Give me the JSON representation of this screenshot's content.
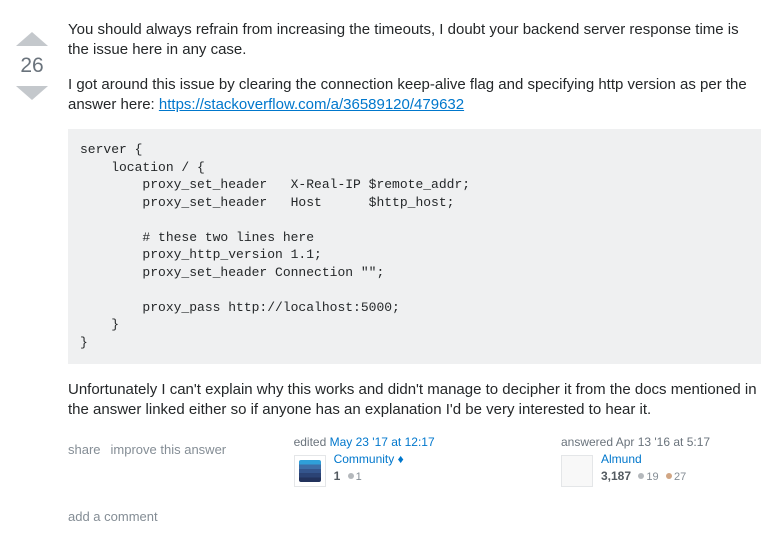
{
  "vote": {
    "count": "26"
  },
  "post": {
    "p1": "You should always refrain from increasing the timeouts, I doubt your backend server response time is the issue here in any case.",
    "p2a": "I got around this issue by clearing the connection keep-alive flag and specifying http version as per the answer here: ",
    "p2link": "https://stackoverflow.com/a/36589120/479632",
    "code": "server {\n    location / {\n        proxy_set_header   X-Real-IP $remote_addr;\n        proxy_set_header   Host      $http_host;\n\n        # these two lines here\n        proxy_http_version 1.1;\n        proxy_set_header Connection \"\";\n\n        proxy_pass http://localhost:5000;\n    }\n}",
    "p3": "Unfortunately I can't explain why this works and didn't manage to decipher it from the docs mentioned in the answer linked either so if anyone has an explanation I'd be very interested to hear it."
  },
  "menu": {
    "share": "share",
    "improve": "improve this answer"
  },
  "edited": {
    "action": "edited ",
    "time": "May 23 '17 at 12:17",
    "user": "Community",
    "flair": "♦",
    "rep": "1",
    "silver": "1"
  },
  "answered": {
    "action": "answered ",
    "time": "Apr 13 '16 at 5:17",
    "user": "Almund",
    "rep": "3,187",
    "silver": "19",
    "bronze": "27"
  },
  "comment_link": "add a comment"
}
